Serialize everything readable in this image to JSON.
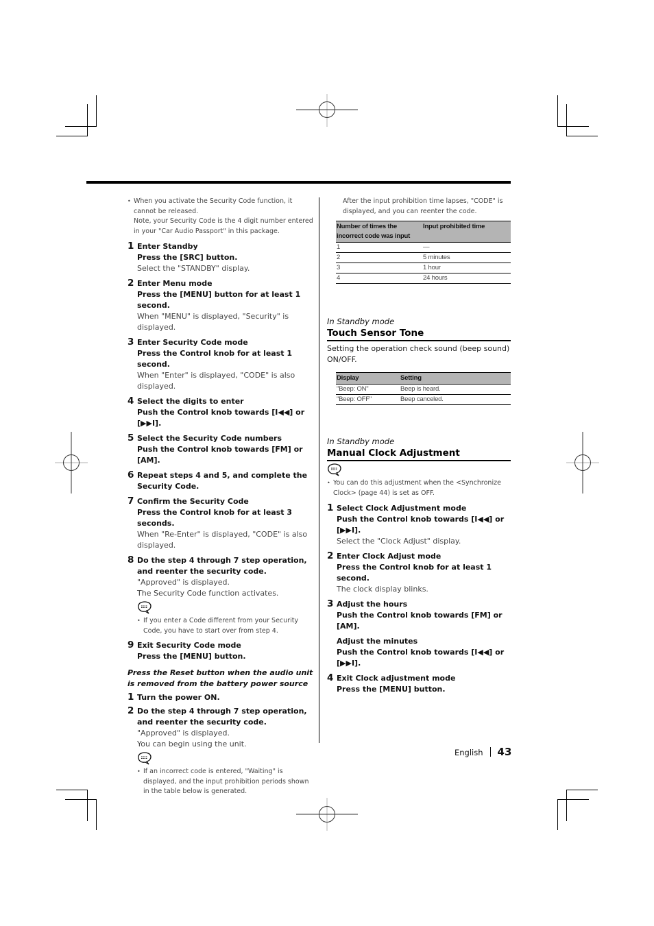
{
  "left": {
    "intro_bullet": "When you activate the Security Code function, it cannot be released.",
    "intro_note": "Note, your Security Code is the 4 digit number entered in your \"Car Audio Passport\" in this package.",
    "steps": [
      {
        "num": "1",
        "title": "Enter Standby",
        "action": "Press the [SRC] button.",
        "desc": "Select the \"STANDBY\" display."
      },
      {
        "num": "2",
        "title": "Enter Menu mode",
        "action": "Press the [MENU] button for at least 1 second.",
        "desc": "When \"MENU\" is displayed, \"Security\" is displayed."
      },
      {
        "num": "3",
        "title": "Enter Security Code mode",
        "action": "Press the Control knob for at least 1 second.",
        "desc": "When \"Enter\" is displayed, \"CODE\" is also displayed."
      },
      {
        "num": "4",
        "title": "Select the digits to enter",
        "action": "Push the Control knob towards [I◀◀] or [▶▶I]."
      },
      {
        "num": "5",
        "title": "Select the Security Code numbers",
        "action": "Push the Control knob towards [FM] or [AM]."
      },
      {
        "num": "6",
        "title": "Repeat steps 4 and 5, and complete the Security Code."
      },
      {
        "num": "7",
        "title": "Confirm the Security Code",
        "action": "Press the Control knob for at least 3 seconds.",
        "desc": "When \"Re-Enter\" is displayed, \"CODE\" is also displayed."
      },
      {
        "num": "8",
        "title": "Do the step 4 through 7 step operation, and reenter the security code.",
        "desc1": "\"Approved\" is displayed.",
        "desc2": "The Security Code function activates.",
        "note": "If you enter a Code different from your Security Code, you have to start over from step 4."
      },
      {
        "num": "9",
        "title": "Exit Security Code mode",
        "action": "Press the [MENU] button."
      }
    ],
    "reset_heading": "Press the Reset button when the audio unit is removed from the battery power source",
    "reset_steps": [
      {
        "num": "1",
        "title": "Turn the power ON."
      },
      {
        "num": "2",
        "title": "Do the step 4 through 7 step operation, and reenter the security code.",
        "desc1": "\"Approved\" is displayed.",
        "desc2": "You can begin using the unit.",
        "note": "If an incorrect code is entered, \"Waiting\" is displayed, and the input prohibition periods shown in the table below is generated."
      }
    ]
  },
  "right": {
    "continued_note": "After the input prohibition time lapses, \"CODE\" is displayed, and you can reenter the code.",
    "prohibit_table": {
      "headers": [
        "Number of times the incorrect code was input",
        "Input prohibited time"
      ],
      "rows": [
        [
          "1",
          "—"
        ],
        [
          "2",
          "5 minutes"
        ],
        [
          "3",
          "1 hour"
        ],
        [
          "4",
          "24 hours"
        ]
      ]
    },
    "touch": {
      "mode": "In Standby mode",
      "heading": "Touch Sensor Tone",
      "intro": "Setting the operation check sound (beep sound) ON/OFF.",
      "table": {
        "headers": [
          "Display",
          "Setting"
        ],
        "rows": [
          [
            "\"Beep: ON\"",
            "Beep is heard."
          ],
          [
            "\"Beep: OFF\"",
            "Beep canceled."
          ]
        ]
      }
    },
    "clock": {
      "mode": "In Standby mode",
      "heading": "Manual Clock Adjustment",
      "note": "You can do this adjustment when the <Synchronize Clock> (page 44) is set as OFF.",
      "steps": [
        {
          "num": "1",
          "title": "Select Clock Adjustment mode",
          "action": "Push the Control knob towards [I◀◀] or [▶▶I].",
          "desc": "Select the \"Clock Adjust\" display."
        },
        {
          "num": "2",
          "title": "Enter Clock Adjust mode",
          "action": "Press the Control knob for at least 1 second.",
          "desc": "The clock display blinks."
        },
        {
          "num": "3",
          "title": "Adjust the hours",
          "action": "Push the Control knob towards [FM] or [AM].",
          "subtitle": "Adjust the minutes",
          "subaction": "Push the Control knob towards [I◀◀] or [▶▶I]."
        },
        {
          "num": "4",
          "title": "Exit Clock adjustment mode",
          "action": "Press the [MENU] button."
        }
      ]
    }
  },
  "footer": {
    "language": "English",
    "page_number": "43"
  }
}
